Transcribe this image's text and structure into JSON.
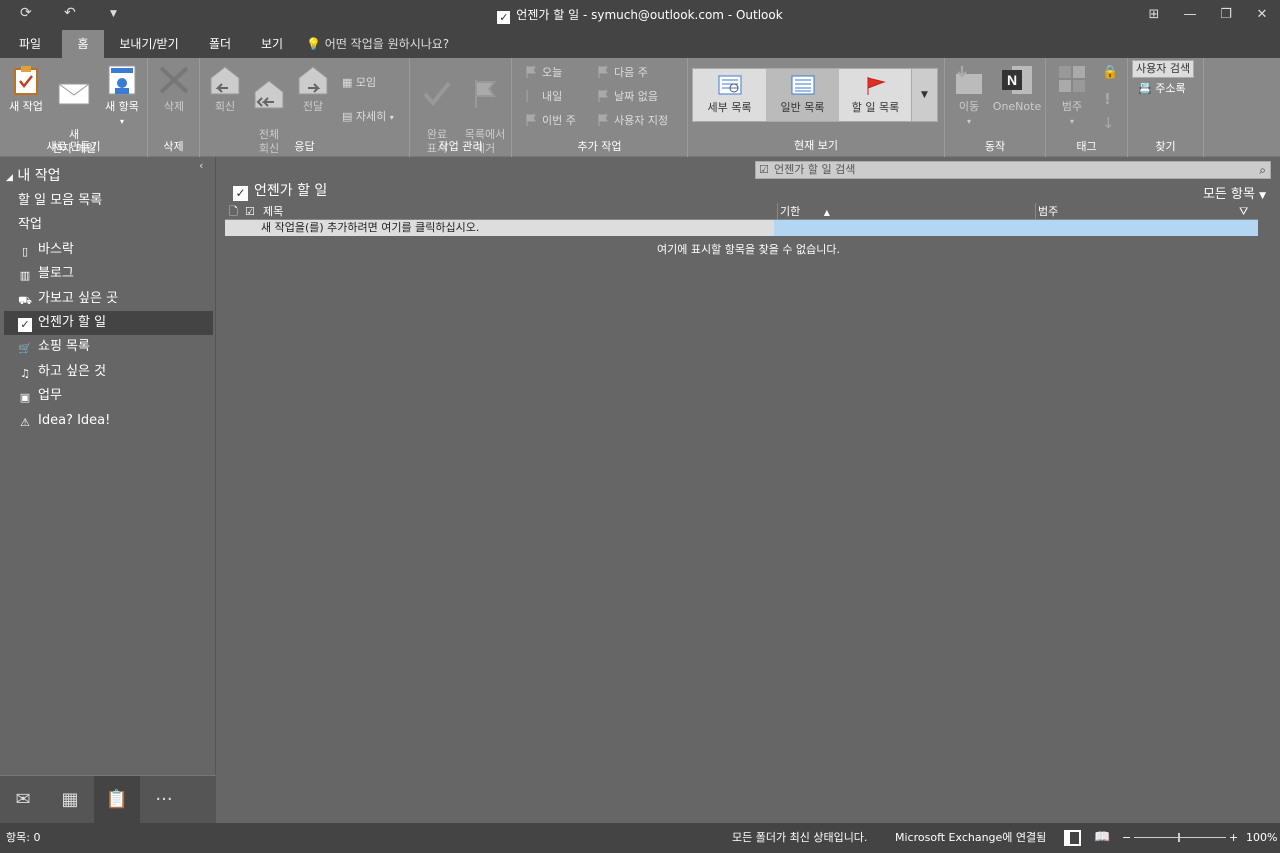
{
  "titlebar": {
    "title": "언젠가 할 일 - symuch@outlook.com  -  Outlook",
    "minimize_icon": "minimize-icon",
    "restore_icon": "restore-icon",
    "close_icon": "close-icon"
  },
  "tabs": [
    {
      "label": "파일"
    },
    {
      "label": "홈"
    },
    {
      "label": "보내기/받기"
    },
    {
      "label": "폴더"
    },
    {
      "label": "보기"
    }
  ],
  "tellme": "어떤 작업을 원하시나요?",
  "ribbon": {
    "new_group": {
      "label": "새로 만들기",
      "new_task": "새 작업",
      "new_email": "새\n전자 메일",
      "new_items": "새 항목"
    },
    "delete_group": {
      "label": "삭제",
      "delete": "삭제"
    },
    "respond_group": {
      "label": "응답",
      "reply": "회신",
      "reply_all": "전체\n회신",
      "forward": "전달",
      "meeting": "모임",
      "more": "자세히"
    },
    "manage_group": {
      "label": "작업 관리",
      "mark_complete": "완료\n표시",
      "remove_from_list": "목록에서\n제거"
    },
    "followup_group": {
      "label": "추가 작업",
      "today": "오늘",
      "tomorrow": "내일",
      "this_week": "이번 주",
      "next_week": "다음 주",
      "no_date": "날짜 없음",
      "custom": "사용자 지정"
    },
    "view_group": {
      "label": "현재 보기",
      "detailed": "세부 목록",
      "simple": "일반 목록",
      "todo": "할 일 목록"
    },
    "actions_group": {
      "label": "동작",
      "move": "이동",
      "onenote": "OneNote"
    },
    "tags_group": {
      "label": "태그",
      "categorize": "범주"
    },
    "find_group": {
      "label": "찾기",
      "search_people": "사용자 검색",
      "address_book": "주소록"
    }
  },
  "sidebar": {
    "header": "내 작업",
    "items": [
      {
        "label": "할 일 모음 목록",
        "icon": ""
      },
      {
        "label": "작업",
        "icon": ""
      },
      {
        "label": "바스락",
        "icon": "notebook-icon"
      },
      {
        "label": "블로그",
        "icon": "building-icon"
      },
      {
        "label": "가보고 싶은 곳",
        "icon": "car-icon"
      },
      {
        "label": "언젠가 할 일",
        "icon": "checkbox-icon"
      },
      {
        "label": "쇼핑 목록",
        "icon": "cart-icon"
      },
      {
        "label": "하고 싶은 것",
        "icon": "music-icon"
      },
      {
        "label": "업무",
        "icon": "briefcase-icon"
      },
      {
        "label": "Idea? Idea!",
        "icon": "warning-icon"
      }
    ]
  },
  "main": {
    "search_placeholder": "언젠가 할 일 검색",
    "folder_title": "언젠가 할 일",
    "filter": "모든 항목",
    "columns": {
      "subject": "제목",
      "due": "기한",
      "category": "범주"
    },
    "new_task_prompt": "새 작업을(를) 추가하려면 여기를 클릭하십시오.",
    "empty_message": "여기에 표시할 항목을 찾을 수 없습니다."
  },
  "status": {
    "items": "항목: 0",
    "sync": "모든 폴더가 최신 상태입니다.",
    "connection": "Microsoft Exchange에 연결됨",
    "zoom": "100%"
  }
}
